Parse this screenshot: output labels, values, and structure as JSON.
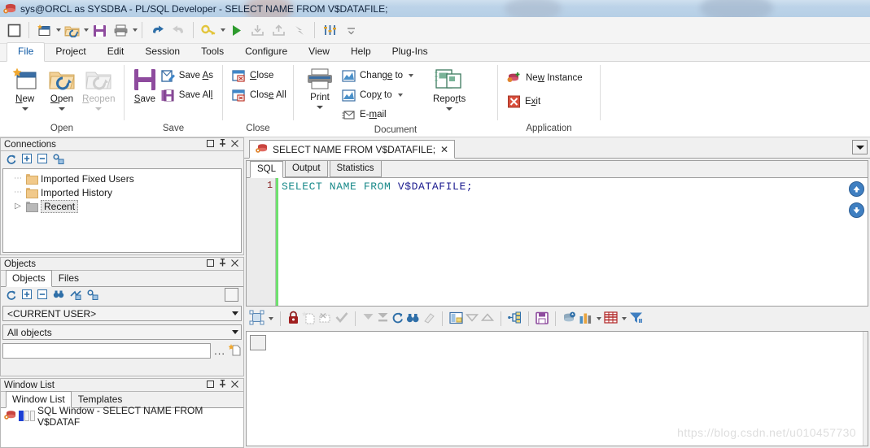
{
  "window": {
    "title": "sys@ORCL as SYSDBA - PL/SQL Developer - SELECT NAME FROM V$DATAFILE;",
    "app_icon": "oracle-db-icon"
  },
  "quick_toolbar": {
    "buttons": [
      {
        "name": "stop-button",
        "icon": "square-icon"
      },
      {
        "name": "new-window-button",
        "icon": "new-window-icon"
      },
      {
        "name": "open-button",
        "icon": "open-folder-icon"
      },
      {
        "name": "save-button",
        "icon": "save-disk-icon"
      },
      {
        "name": "print-button",
        "icon": "printer-icon"
      },
      {
        "name": "undo-button",
        "icon": "undo-arrow-icon"
      },
      {
        "name": "redo-button",
        "icon": "redo-arrow-icon"
      },
      {
        "name": "logon-button",
        "icon": "key-icon"
      },
      {
        "name": "execute-button",
        "icon": "play-triangle-icon"
      },
      {
        "name": "import-button",
        "icon": "download-icon"
      },
      {
        "name": "export-button",
        "icon": "upload-icon"
      },
      {
        "name": "break-button",
        "icon": "break-icon"
      },
      {
        "name": "preferences-button",
        "icon": "sliders-icon"
      }
    ],
    "overflow_label": "more-options"
  },
  "menu": {
    "items": [
      {
        "label": "File",
        "active": true
      },
      {
        "label": "Project",
        "active": false
      },
      {
        "label": "Edit",
        "active": false
      },
      {
        "label": "Session",
        "active": false
      },
      {
        "label": "Tools",
        "active": false
      },
      {
        "label": "Configure",
        "active": false
      },
      {
        "label": "View",
        "active": false
      },
      {
        "label": "Help",
        "active": false
      },
      {
        "label": "Plug-Ins",
        "active": false
      }
    ]
  },
  "ribbon": {
    "groups": [
      {
        "name": "open",
        "label": "Open",
        "big_buttons": [
          {
            "label": "New",
            "accel": "N",
            "icon": "new-document-icon",
            "disabled": false,
            "has_caret": true
          },
          {
            "label": "Open",
            "accel": "O",
            "icon": "open-folder-icon",
            "disabled": false,
            "has_caret": true
          },
          {
            "label": "Reopen",
            "accel": "R",
            "icon": "reopen-folder-icon",
            "disabled": true,
            "has_caret": true
          }
        ]
      },
      {
        "name": "save",
        "label": "Save",
        "big_buttons": [
          {
            "label": "Save",
            "accel": "S",
            "icon": "save-disk-icon",
            "disabled": false,
            "has_caret": false
          }
        ],
        "small_buttons": [
          {
            "label": "Save As",
            "icon": "save-as-icon"
          },
          {
            "label": "Save All",
            "icon": "save-all-icon"
          }
        ]
      },
      {
        "name": "close",
        "label": "Close",
        "small_buttons": [
          {
            "label": "Close",
            "icon": "close-window-icon"
          },
          {
            "label": "Close All",
            "icon": "close-all-windows-icon"
          }
        ]
      },
      {
        "name": "document",
        "label": "Document",
        "big_buttons": [
          {
            "label": "Print",
            "accel": "P",
            "icon": "printer-icon",
            "disabled": false,
            "has_caret": true
          }
        ],
        "small_buttons": [
          {
            "label": "Change to",
            "icon": "change-to-icon",
            "has_caret": true
          },
          {
            "label": "Copy to",
            "icon": "copy-to-icon",
            "has_caret": true
          },
          {
            "label": "E-mail",
            "icon": "email-icon",
            "has_caret": false
          }
        ],
        "reports": {
          "label": "Reports",
          "icon": "reports-icon"
        }
      },
      {
        "name": "application",
        "label": "Application",
        "small_buttons": [
          {
            "label": "New Instance",
            "icon": "new-instance-icon"
          },
          {
            "label": "Exit",
            "icon": "exit-x-icon"
          }
        ]
      }
    ]
  },
  "connections_panel": {
    "title": "Connections",
    "window_buttons": [
      "maximize-icon",
      "pin-icon",
      "close-icon"
    ],
    "toolbar_icons": [
      "refresh-icon",
      "expand-all-icon",
      "collapse-all-icon",
      "new-connection-icon"
    ],
    "tree": [
      {
        "label": "Imported Fixed Users",
        "icon": "folder-icon",
        "selected": false,
        "expander": false
      },
      {
        "label": "Imported History",
        "icon": "folder-icon",
        "selected": false,
        "expander": false
      },
      {
        "label": "Recent",
        "icon": "folder-grey-icon",
        "selected": true,
        "expander": true
      }
    ]
  },
  "objects_panel": {
    "title": "Objects",
    "window_buttons": [
      "maximize-icon",
      "pin-icon",
      "close-icon"
    ],
    "tabs": [
      {
        "label": "Objects",
        "active": true
      },
      {
        "label": "Files",
        "active": false
      }
    ],
    "toolbar_icons": [
      "refresh-icon",
      "expand-all-icon",
      "collapse-all-icon",
      "find-icon",
      "filter-edit-icon",
      "new-object-icon"
    ],
    "owner_select": {
      "value": "<CURRENT USER>",
      "name": "owner-dropdown"
    },
    "type_select": {
      "value": "All objects",
      "name": "object-type-dropdown"
    },
    "search": {
      "value": "",
      "placeholder": "",
      "browse_label": "...",
      "new_icon": "new-item-icon"
    }
  },
  "window_list_panel": {
    "title": "Window List",
    "window_buttons": [
      "maximize-icon",
      "pin-icon",
      "close-icon"
    ],
    "tabs": [
      {
        "label": "Window List",
        "active": true
      },
      {
        "label": "Templates",
        "active": false
      }
    ],
    "items": [
      {
        "label": "SQL Window - SELECT NAME FROM V$DATAF",
        "icon": "oracle-db-icon"
      }
    ]
  },
  "editor": {
    "document_tab": {
      "label": "SELECT NAME FROM V$DATAFILE;",
      "icon": "oracle-db-icon",
      "close_label": "✕"
    },
    "tabbar_dropdown": "chevron-down-icon",
    "sub_tabs": [
      {
        "label": "SQL",
        "active": true
      },
      {
        "label": "Output",
        "active": false
      },
      {
        "label": "Statistics",
        "active": false
      }
    ],
    "line_numbers": [
      "1"
    ],
    "code_tokens": [
      {
        "text": "SELECT NAME FROM ",
        "type": "keyword"
      },
      {
        "text": "V$DATAFILE;",
        "type": "identifier"
      }
    ],
    "nav_buttons": [
      {
        "name": "scroll-up-button",
        "icon": "arrow-up-circle-icon"
      },
      {
        "name": "scroll-down-button",
        "icon": "arrow-down-circle-icon"
      }
    ]
  },
  "results_toolbar": {
    "buttons": [
      {
        "name": "grid-layout-button",
        "icon": "grid-layout-icon",
        "has_caret": true
      },
      {
        "name": "lock-button",
        "icon": "red-lock-icon"
      },
      {
        "name": "insert-record-button",
        "icon": "insert-record-icon"
      },
      {
        "name": "delete-record-button",
        "icon": "delete-record-icon"
      },
      {
        "name": "post-changes-button",
        "icon": "checkmark-icon"
      },
      {
        "name": "fetch-next-page-button",
        "icon": "double-down-arrow-icon"
      },
      {
        "name": "fetch-last-page-button",
        "icon": "down-arrow-bar-icon"
      },
      {
        "name": "refresh-button",
        "icon": "refresh-icon"
      },
      {
        "name": "find-button",
        "icon": "binoculars-icon"
      },
      {
        "name": "clear-filter-button",
        "icon": "eraser-icon"
      },
      {
        "name": "single-record-view-button",
        "icon": "single-record-icon"
      },
      {
        "name": "previous-record-button",
        "icon": "triangle-down-icon"
      },
      {
        "name": "next-record-button",
        "icon": "triangle-up-icon"
      },
      {
        "name": "explain-plan-button",
        "icon": "plan-tree-icon"
      },
      {
        "name": "export-results-button",
        "icon": "save-disk-icon"
      },
      {
        "name": "query-data-button",
        "icon": "db-arrow-icon"
      },
      {
        "name": "chart-button",
        "icon": "bar-chart-icon",
        "has_caret": true
      },
      {
        "name": "table-view-button",
        "icon": "red-table-icon",
        "has_caret": true
      },
      {
        "name": "filter-button",
        "icon": "funnel-icon"
      }
    ]
  },
  "results_grid": {
    "corner_cell": "select-all-cell",
    "rows": [],
    "columns": []
  },
  "watermark": {
    "text": "https://blog.csdn.net/u010457730"
  },
  "colors": {
    "titlebar": "#bcd3e8",
    "ribbon_bg": "#ffffff",
    "accent_blue": "#3f7fc1",
    "keyword": "#1a8a8a",
    "identifier": "#1b1b8f",
    "line_number": "#8b2b2b",
    "modified_mark": "#6fe06f",
    "save_purple": "#8e4b9e",
    "execute_green": "#3a9d3a"
  }
}
